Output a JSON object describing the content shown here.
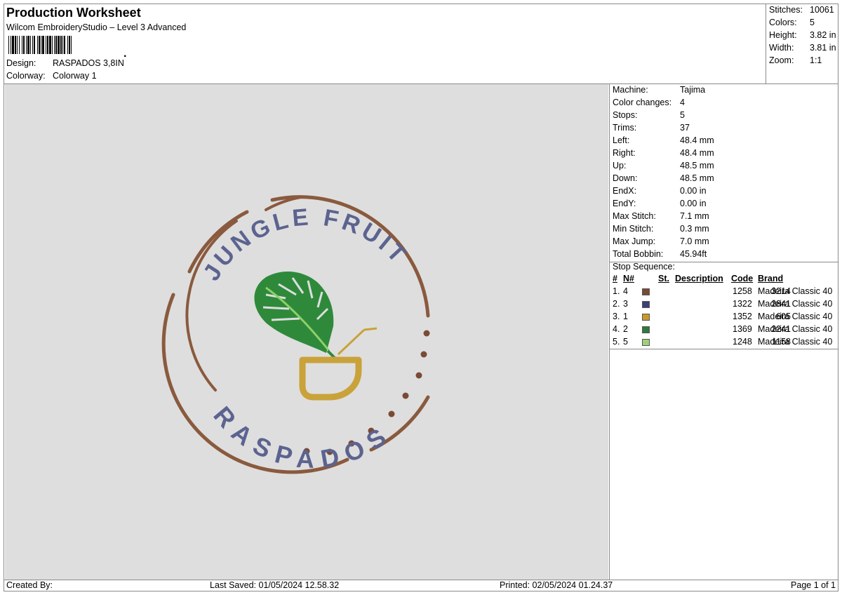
{
  "header": {
    "title": "Production Worksheet",
    "subtitle": "Wilcom EmbroideryStudio – Level 3 Advanced",
    "barcode_label": "barcode",
    "design_label": "Design:",
    "design_value": "RASPADOS 3,8IN",
    "colorway_label": "Colorway:",
    "colorway_value": "Colorway 1"
  },
  "summary": [
    {
      "label": "Stitches:",
      "value": "10061"
    },
    {
      "label": "Colors:",
      "value": "5"
    },
    {
      "label": "Height:",
      "value": "3.82 in"
    },
    {
      "label": "Width:",
      "value": "3.81 in"
    },
    {
      "label": "Zoom:",
      "value": "1:1"
    }
  ],
  "machine_info": [
    {
      "label": "Machine:",
      "value": "Tajima"
    },
    {
      "label": "Color changes:",
      "value": "4"
    },
    {
      "label": "Stops:",
      "value": "5"
    },
    {
      "label": "Trims:",
      "value": "37"
    },
    {
      "label": "Left:",
      "value": "48.4 mm"
    },
    {
      "label": "Right:",
      "value": "48.4 mm"
    },
    {
      "label": "Up:",
      "value": "48.5 mm"
    },
    {
      "label": "Down:",
      "value": "48.5 mm"
    },
    {
      "label": "EndX:",
      "value": "0.00 in"
    },
    {
      "label": "EndY:",
      "value": "0.00 in"
    },
    {
      "label": "Max Stitch:",
      "value": "7.1 mm"
    },
    {
      "label": "Min Stitch:",
      "value": "0.3 mm"
    },
    {
      "label": "Max Jump:",
      "value": "7.0 mm"
    },
    {
      "label": "Total Bobbin:",
      "value": "45.94ft"
    }
  ],
  "stop_sequence": {
    "title": "Stop Sequence:",
    "headers": {
      "num": "#",
      "n": "N#",
      "st": "St.",
      "desc": "Description",
      "code": "Code",
      "brand": "Brand"
    },
    "rows": [
      {
        "num": "1.",
        "n": "4",
        "color": "#7a4a35",
        "st": "3214",
        "desc": "",
        "code": "1258",
        "brand": "Madeira Classic 40"
      },
      {
        "num": "2.",
        "n": "3",
        "color": "#3d3f7a",
        "st": "2841",
        "desc": "",
        "code": "1322",
        "brand": "Madeira Classic 40"
      },
      {
        "num": "3.",
        "n": "1",
        "color": "#c79a2a",
        "st": "605",
        "desc": "",
        "code": "1352",
        "brand": "Madeira Classic 40"
      },
      {
        "num": "4.",
        "n": "2",
        "color": "#2f7a3a",
        "st": "2241",
        "desc": "",
        "code": "1369",
        "brand": "Madeira Classic 40"
      },
      {
        "num": "5.",
        "n": "5",
        "color": "#9fd07a",
        "st": "1158",
        "desc": "",
        "code": "1248",
        "brand": "Madeira Classic 40"
      }
    ]
  },
  "design_text": {
    "top_arc": "JUNGLE FRUIT",
    "bottom_arc": "RASPADOS"
  },
  "colors": {
    "ring": "#8a5a3e",
    "letters": "#5c6390",
    "cup": "#c9a23a",
    "leaf_dark": "#2e8a3a",
    "leaf_light": "#8fd06a",
    "canvas_bg": "#dedede"
  },
  "footer": {
    "created_by": "Created By:",
    "last_saved": "Last Saved: 01/05/2024 12.58.32",
    "printed": "Printed: 02/05/2024 01.24.37",
    "page": "Page 1 of 1"
  }
}
